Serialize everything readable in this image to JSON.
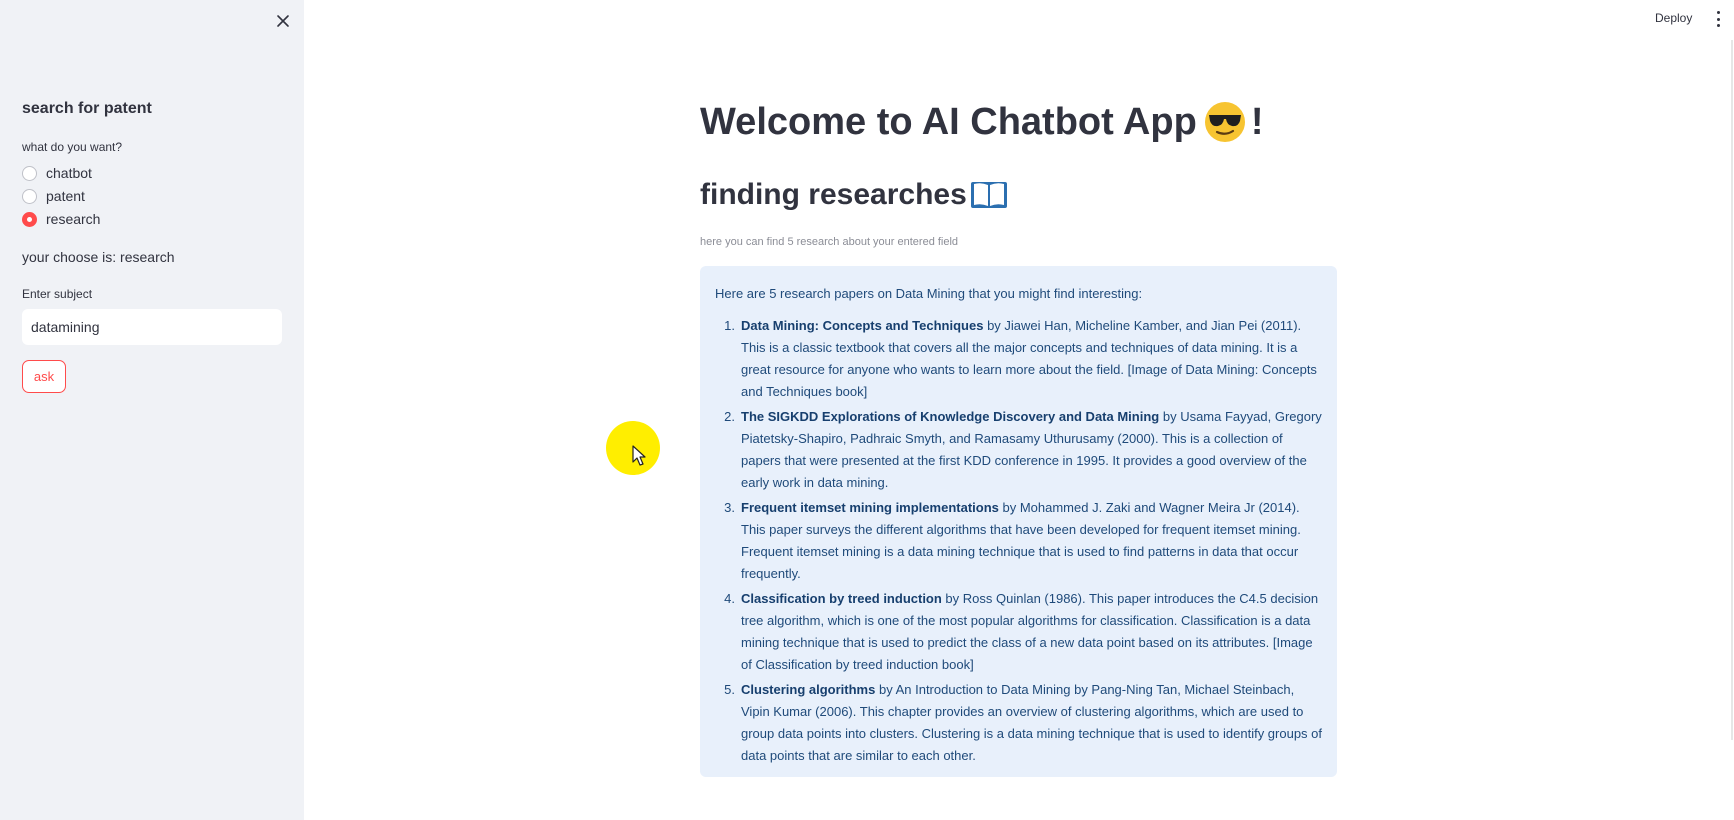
{
  "topbar": {
    "deploy_label": "Deploy"
  },
  "sidebar": {
    "title": "search for patent",
    "question_label": "what do you want?",
    "options": [
      {
        "label": "chatbot",
        "selected": false
      },
      {
        "label": "patent",
        "selected": false
      },
      {
        "label": "research",
        "selected": true
      }
    ],
    "choice_text": "your choose is: research",
    "subject_label": "Enter subject",
    "subject_value": "datamining",
    "ask_label": "ask"
  },
  "main": {
    "title_prefix": "Welcome to AI Chatbot App",
    "title_suffix": "!",
    "subtitle": "finding researches",
    "caption": "here you can find 5 research about your entered field",
    "answer_intro": "Here are 5 research papers on Data Mining that you might find interesting:",
    "papers": [
      {
        "num": "1.",
        "title": "Data Mining: Concepts and Techniques",
        "text": " by Jiawei Han, Micheline Kamber, and Jian Pei (2011). This is a classic textbook that covers all the major concepts and techniques of data mining. It is a great resource for anyone who wants to learn more about the field. [Image of Data Mining: Concepts and Techniques book]"
      },
      {
        "num": "2.",
        "title": "The SIGKDD Explorations of Knowledge Discovery and Data Mining",
        "text": " by Usama Fayyad, Gregory Piatetsky-Shapiro, Padhraic Smyth, and Ramasamy Uthurusamy (2000). This is a collection of papers that were presented at the first KDD conference in 1995. It provides a good overview of the early work in data mining."
      },
      {
        "num": "3.",
        "title": "Frequent itemset mining implementations",
        "text": " by Mohammed J. Zaki and Wagner Meira Jr (2014). This paper surveys the different algorithms that have been developed for frequent itemset mining. Frequent itemset mining is a data mining technique that is used to find patterns in data that occur frequently."
      },
      {
        "num": "4.",
        "title": "Classification by treed induction",
        "text": " by Ross Quinlan (1986). This paper introduces the C4.5 decision tree algorithm, which is one of the most popular algorithms for classification. Classification is a data mining technique that is used to predict the class of a new data point based on its attributes. [Image of Classification by treed induction book]"
      },
      {
        "num": "5.",
        "title": "Clustering algorithms",
        "text": " by An Introduction to Data Mining by Pang-Ning Tan, Michael Steinbach, Vipin Kumar (2006). This chapter provides an overview of clustering algorithms, which are used to group data points into clusters. Clustering is a data mining technique that is used to identify groups of data points that are similar to each other."
      }
    ]
  },
  "icons": {
    "close": "close-icon",
    "kebab": "kebab-menu-icon",
    "emoji": "sunglasses-face-emoji",
    "book": "open-book-emoji"
  },
  "colors": {
    "accent": "#ff4b4b",
    "sidebar_bg": "#f0f2f6",
    "answer_bg": "#e8f0fb",
    "answer_text": "#1f4a7a"
  }
}
